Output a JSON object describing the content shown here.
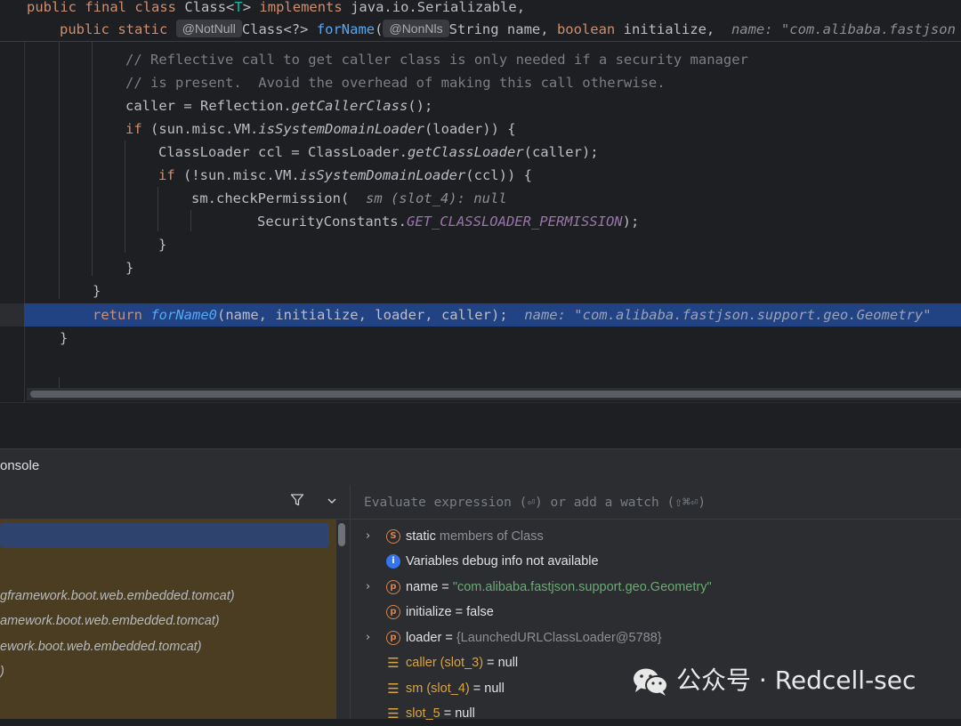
{
  "editor": {
    "header_line1": {
      "kw1": "public",
      "kw2": "final",
      "kw3": "class",
      "cls": "Class<",
      "tp": "T",
      "cls2": ">",
      "kw4": "implements",
      "rest": "java.io.Serializable,"
    },
    "header_line2": {
      "kw1": "public",
      "kw2": "static",
      "anno1": "@NotNull",
      "ret": "Class<?>",
      "fn": "forName",
      "paren": "(",
      "anno2": "@NonNls",
      "p1": "String name,",
      "kw3": "boolean",
      "p2": "initialize,",
      "hint": "name: \"com.alibaba.fastjson"
    },
    "lines": {
      "c1": "// Reflective call to get caller class is only needed if a security manager",
      "c2": "// is present.  Avoid the overhead of making this call otherwise.",
      "l3a": "caller = Reflection.",
      "l3b": "getCallerClass",
      "l3c": "();",
      "l4kw": "if",
      "l4a": " (sun.misc.VM.",
      "l4b": "isSystemDomainLoader",
      "l4c": "(loader)) {",
      "l5a": "ClassLoader ccl = ClassLoader.",
      "l5b": "getClassLoader",
      "l5c": "(caller);",
      "l6kw": "if",
      "l6a": " (!sun.misc.VM.",
      "l6b": "isSystemDomainLoader",
      "l6c": "(ccl)) {",
      "l7a": "sm.checkPermission(",
      "l7hint": "sm (slot_4): null",
      "l8a": "SecurityConstants.",
      "l8b": "GET_CLASSLOADER_PERMISSION",
      "l8c": ");",
      "l9": "}",
      "l10": "}",
      "l11": "}",
      "l12kw": "return",
      "l12fn": "forName0",
      "l12a": "(name, initialize, loader, caller);",
      "l12hint": "name: \"com.alibaba.fastjson.support.geo.Geometry\"",
      "l13": "}"
    }
  },
  "tool_window": {
    "tab_label": "onsole"
  },
  "frames": {
    "filter_icon": "filter-icon",
    "dropdown_icon": "chevron-down-icon",
    "rows": [
      "",
      "gframework.boot.web.embedded.tomcat)",
      "amework.boot.web.embedded.tomcat)",
      "ework.boot.web.embedded.tomcat)",
      ")"
    ]
  },
  "variables": {
    "eval_placeholder": "Evaluate expression (⏎) or add a watch (⇧⌘⏎)",
    "rows": [
      {
        "icon": "S",
        "name": "static",
        "rest": " members of Class"
      },
      {
        "icon": "i",
        "name": "Variables debug info not available",
        "rest": ""
      },
      {
        "icon": "p",
        "name": "name",
        "eq": " = ",
        "val": "\"com.alibaba.fastjson.support.geo.Geometry\""
      },
      {
        "icon": "p",
        "name": "initialize",
        "eq": " = ",
        "val": "false"
      },
      {
        "icon": "p",
        "name": "loader",
        "eq": " = ",
        "val": "{LaunchedURLClassLoader@5788}"
      },
      {
        "icon": "slot",
        "name": "caller (slot_3)",
        "eq": " = ",
        "val": "null"
      },
      {
        "icon": "slot",
        "name": "sm (slot_4)",
        "eq": " = ",
        "val": "null"
      },
      {
        "icon": "slot",
        "name": "slot_5",
        "eq": " = ",
        "val": "null"
      }
    ]
  },
  "watermark": {
    "text": "公众号 · Redcell-sec"
  },
  "colors": {
    "highlight": "#214283",
    "keyword": "#cf8e6d",
    "function": "#56a8f5",
    "comment": "#7a7e85",
    "constant": "#9876aa",
    "frames_bg": "#4a3d22"
  }
}
